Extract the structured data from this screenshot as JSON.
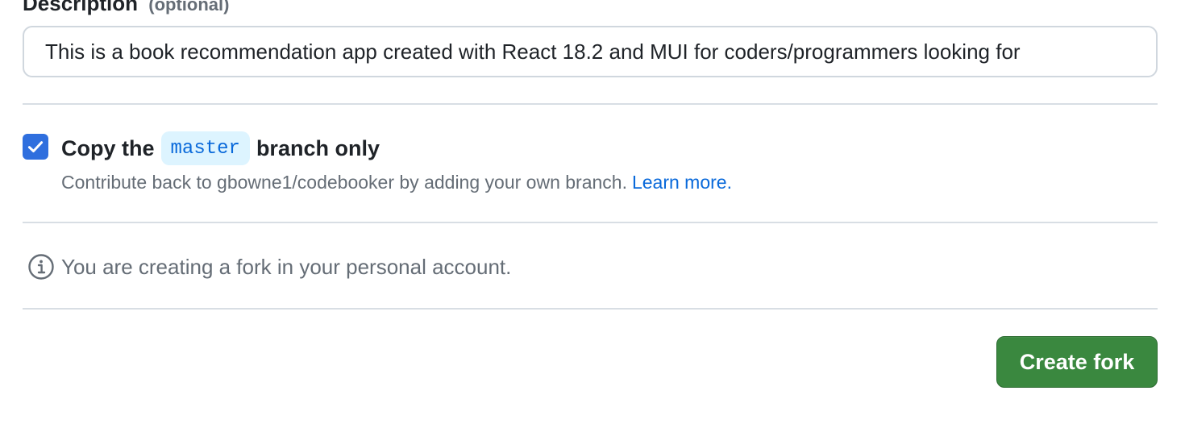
{
  "description": {
    "label": "Description",
    "optional_label": "(optional)",
    "value": "This is a book recommendation app created with React 18.2 and MUI for coders/programmers looking for"
  },
  "copy_branch": {
    "checked": true,
    "label_prefix": "Copy the",
    "branch_name": "master",
    "label_suffix": "branch only",
    "help_text": "Contribute back to gbowne1/codebooker by adding your own branch.",
    "learn_more": "Learn more."
  },
  "info": {
    "icon": "info-icon",
    "text": "You are creating a fork in your personal account."
  },
  "actions": {
    "create_fork_label": "Create fork"
  },
  "colors": {
    "accent": "#0969da",
    "checkbox": "#2f6fde",
    "primary_button": "#3a883f",
    "muted_text": "#656d76"
  }
}
